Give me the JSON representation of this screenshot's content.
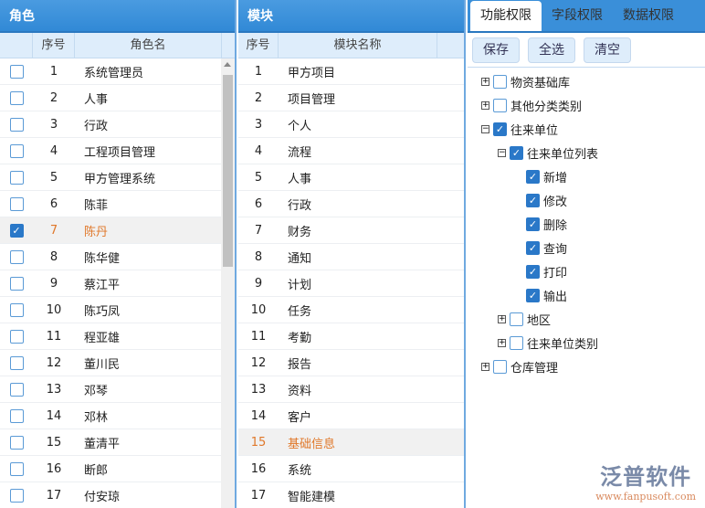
{
  "roles": {
    "title": "角色",
    "col_no": "序号",
    "col_name": "角色名",
    "selected_index": 6,
    "rows": [
      "系统管理员",
      "人事",
      "行政",
      "工程项目管理",
      "甲方管理系统",
      "陈菲",
      "陈丹",
      "陈华健",
      "蔡江平",
      "陈巧凤",
      "程亚雄",
      "董川民",
      "邓琴",
      "邓林",
      "董清平",
      "断郎",
      "付安琼"
    ]
  },
  "modules": {
    "title": "模块",
    "col_no": "序号",
    "col_name": "模块名称",
    "selected_index": 14,
    "rows": [
      "甲方项目",
      "项目管理",
      "个人",
      "流程",
      "人事",
      "行政",
      "财务",
      "通知",
      "计划",
      "任务",
      "考勤",
      "报告",
      "资料",
      "客户",
      "基础信息",
      "系统",
      "智能建模"
    ]
  },
  "perm": {
    "tabs": [
      "功能权限",
      "字段权限",
      "数据权限"
    ],
    "buttons": {
      "save": "保存",
      "select_all": "全选",
      "clear": "清空"
    },
    "tree": [
      {
        "label": "物资基础库",
        "level": 0,
        "exp": "+",
        "checked": false
      },
      {
        "label": "其他分类类别",
        "level": 0,
        "exp": "+",
        "checked": false
      },
      {
        "label": "往来单位",
        "level": 0,
        "exp": "-",
        "checked": true
      },
      {
        "label": "往来单位列表",
        "level": 1,
        "exp": "-",
        "checked": true
      },
      {
        "label": "新增",
        "level": 2,
        "exp": "",
        "checked": true
      },
      {
        "label": "修改",
        "level": 2,
        "exp": "",
        "checked": true
      },
      {
        "label": "删除",
        "level": 2,
        "exp": "",
        "checked": true
      },
      {
        "label": "查询",
        "level": 2,
        "exp": "",
        "checked": true
      },
      {
        "label": "打印",
        "level": 2,
        "exp": "",
        "checked": true
      },
      {
        "label": "输出",
        "level": 2,
        "exp": "",
        "checked": true
      },
      {
        "label": "地区",
        "level": 1,
        "exp": "+",
        "checked": false
      },
      {
        "label": "往来单位类别",
        "level": 1,
        "exp": "+",
        "checked": false
      },
      {
        "label": "仓库管理",
        "level": 0,
        "exp": "+",
        "checked": false
      }
    ]
  },
  "logo": {
    "name": "泛普软件",
    "url": "www.fanpusoft.com"
  }
}
